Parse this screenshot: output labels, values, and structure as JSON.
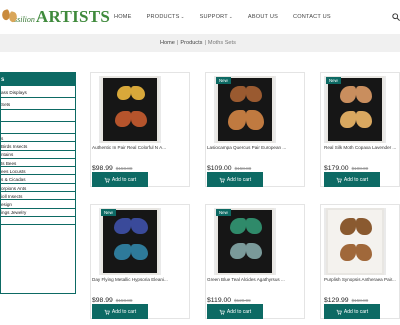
{
  "brand": {
    "small": "ssilion",
    "big": "ARTISTS"
  },
  "nav": [
    {
      "label": "HOME",
      "dropdown": false
    },
    {
      "label": "PRODUCTS",
      "dropdown": true
    },
    {
      "label": "SUPPORT",
      "dropdown": true
    },
    {
      "label": "ABOUT US",
      "dropdown": false
    },
    {
      "label": "CONTACT US",
      "dropdown": false
    }
  ],
  "breadcrumb": {
    "home": "Home",
    "sep": "|",
    "products": "Products",
    "current": "Moths Sets"
  },
  "sidebar": {
    "title": "s",
    "items": [
      "ass Displays",
      "Sets",
      "",
      "",
      "s",
      "Birds Insects",
      "ntains",
      "ts Bees",
      "ees Locusts",
      "s & Cicadas",
      "orpions Ants",
      "ioll Insects",
      "esign",
      "ings Jewelry",
      ""
    ]
  },
  "products": [
    {
      "title": "Authentic In Pair Real Colorful N A...",
      "price": "$98.99",
      "old_price": "$158.88",
      "is_new": false,
      "button": "Add to cart"
    },
    {
      "title": "Lasiocampa Quercus Pair European ...",
      "price": "$109.00",
      "old_price": "$158.88",
      "is_new": true,
      "badge": "New",
      "button": "Add to cart"
    },
    {
      "title": "Real Silk Moth Copaxa Lavender ...",
      "price": "$179.00",
      "old_price": "$198.00",
      "is_new": true,
      "badge": "New",
      "button": "Add to cart"
    },
    {
      "title": "Day Flying Metallic Hypsoria Eleani...",
      "price": "$98.99",
      "old_price": "$158.88",
      "is_new": true,
      "badge": "New",
      "button": "Add to cart"
    },
    {
      "title": "Green Blue Teal Alcides Agathyrsus ...",
      "price": "$119.00",
      "old_price": "$129.99",
      "is_new": true,
      "badge": "New",
      "button": "Add to cart"
    },
    {
      "title": "Purplish Synopsis Antheraea Pair...",
      "price": "$129.99",
      "old_price": "$158.88",
      "is_new": false,
      "button": "Add to cart"
    }
  ],
  "colors": {
    "accent": "#0d6a64",
    "brand_green": "#3f8a3c"
  }
}
